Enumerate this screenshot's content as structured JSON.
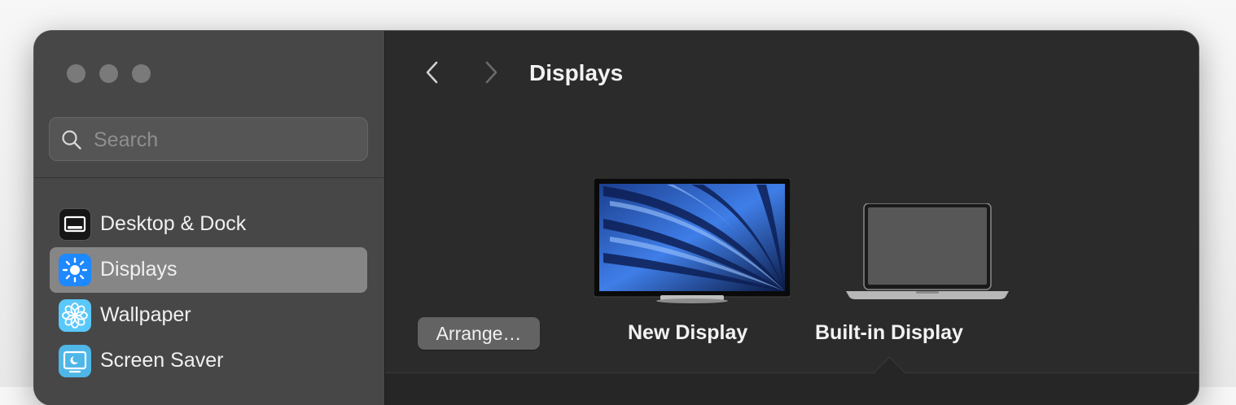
{
  "window": {
    "traffic_lights": [
      "close",
      "minimize",
      "zoom"
    ]
  },
  "search": {
    "placeholder": "Search",
    "value": ""
  },
  "sidebar": {
    "items": [
      {
        "label": "Desktop & Dock",
        "icon": "desktop-dock-icon",
        "color": "#1c1c1e",
        "selected": false
      },
      {
        "label": "Displays",
        "icon": "sun-icon",
        "color": "#1e88ff",
        "selected": true
      },
      {
        "label": "Wallpaper",
        "icon": "flower-icon",
        "color": "#5ac8fa",
        "selected": false
      },
      {
        "label": "Screen Saver",
        "icon": "screen-saver-icon",
        "color": "#4fb6e8",
        "selected": false
      }
    ]
  },
  "header": {
    "title": "Displays",
    "back_icon": "chevron-left-icon",
    "forward_icon": "chevron-right-icon"
  },
  "arrangement": {
    "arrange_button": "Arrange…",
    "displays": [
      {
        "label": "New Display",
        "icon": "external-monitor-icon",
        "selected": false
      },
      {
        "label": "Built-in Display",
        "icon": "laptop-icon",
        "selected": true
      }
    ]
  },
  "colors": {
    "sidebar_bg": "#474747",
    "main_bg": "#2b2b2b",
    "selected_item": "#868686",
    "accent": "#1e88ff"
  }
}
